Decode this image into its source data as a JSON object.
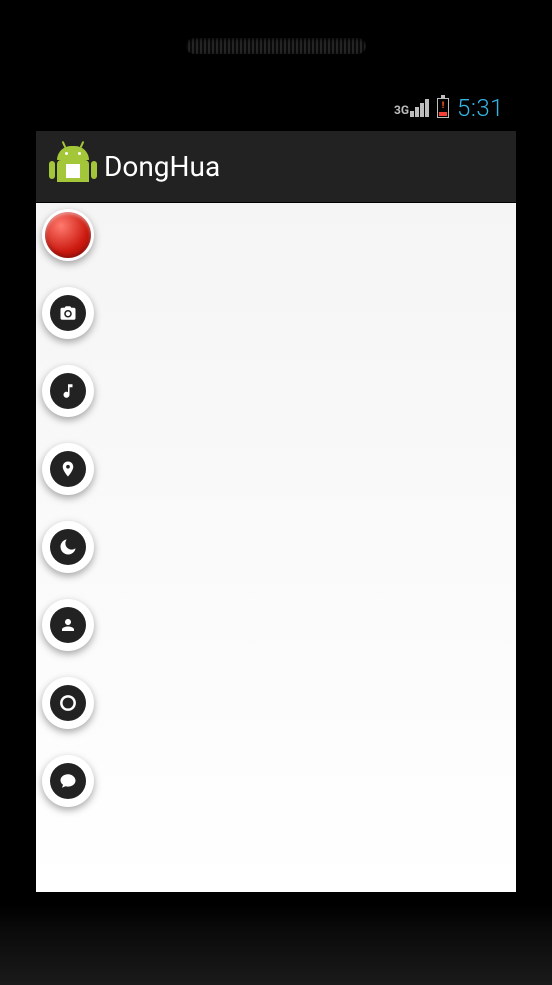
{
  "status_bar": {
    "network": "3G",
    "time": "5:31"
  },
  "action_bar": {
    "title": "DongHua"
  },
  "fab": {
    "main_name": "record-button",
    "items": [
      {
        "name": "camera-icon"
      },
      {
        "name": "music-icon"
      },
      {
        "name": "location-icon"
      },
      {
        "name": "moon-icon"
      },
      {
        "name": "person-icon"
      },
      {
        "name": "circle-icon"
      },
      {
        "name": "chat-icon"
      }
    ]
  }
}
